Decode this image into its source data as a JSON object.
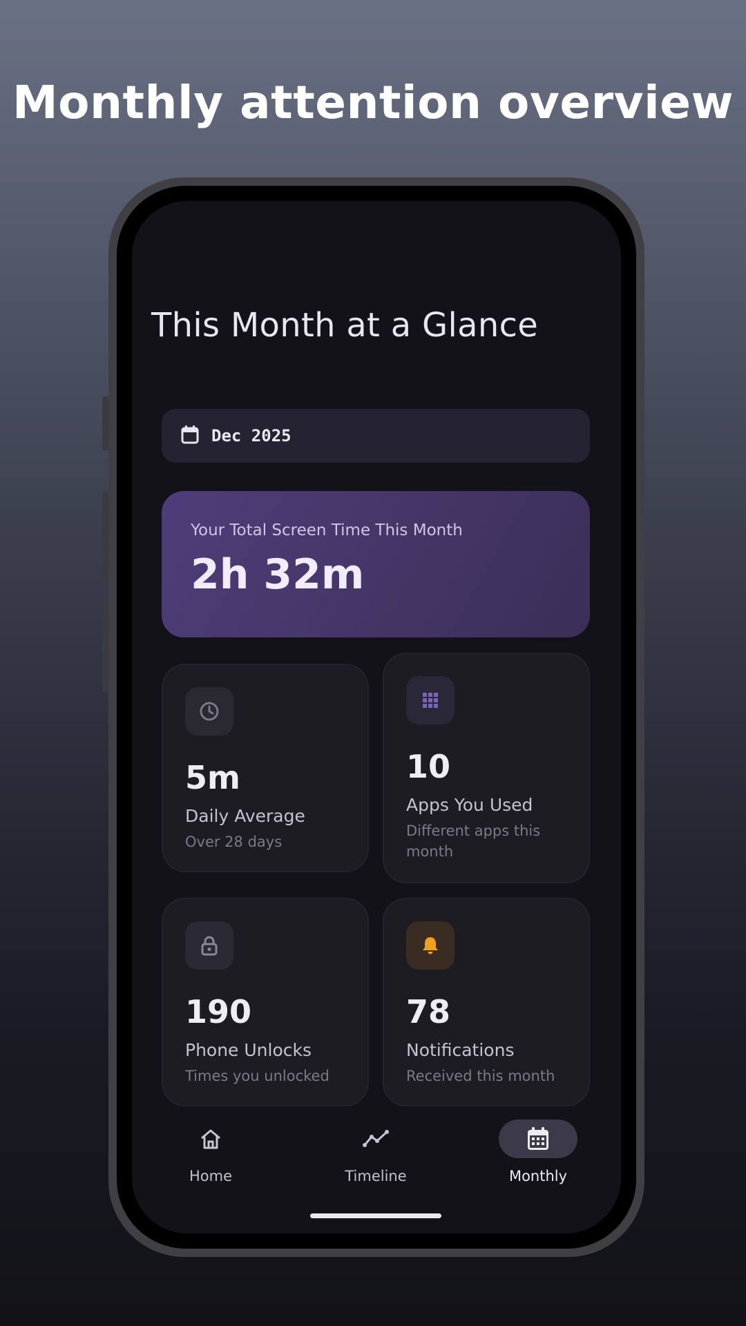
{
  "headline": "Monthly attention overview",
  "page": {
    "title": "This Month at a Glance"
  },
  "month_selector": {
    "icon": "calendar-icon",
    "label": "Dec 2025"
  },
  "total": {
    "caption": "Your Total Screen Time This Month",
    "value": "2h 32m",
    "colors": {
      "from": "#4f3d7a",
      "to": "#3a2f58"
    }
  },
  "stats": [
    {
      "icon": "clock-icon",
      "value": "5m",
      "label": "Daily Average",
      "sub": "Over 28 days"
    },
    {
      "icon": "apps-grid-icon",
      "value": "10",
      "label": "Apps You Used",
      "sub": "Different apps this month"
    },
    {
      "icon": "lock-icon",
      "value": "190",
      "label": "Phone Unlocks",
      "sub": "Times you unlocked"
    },
    {
      "icon": "bell-icon",
      "value": "78",
      "label": "Notifications",
      "sub": "Received this month",
      "accent": "#f0a020"
    }
  ],
  "nav": {
    "items": [
      {
        "icon": "home-icon",
        "label": "Home",
        "active": false
      },
      {
        "icon": "timeline-icon",
        "label": "Timeline",
        "active": false
      },
      {
        "icon": "calendar-grid-icon",
        "label": "Monthly",
        "active": true
      }
    ]
  }
}
